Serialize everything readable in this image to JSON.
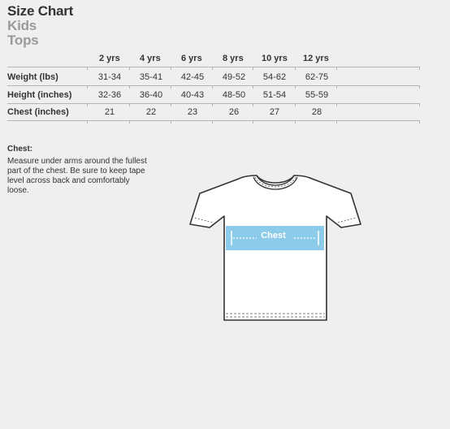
{
  "header": {
    "title": "Size Chart",
    "subtitle1": "Kids",
    "subtitle2": "Tops"
  },
  "table": {
    "columns": [
      "2 yrs",
      "4 yrs",
      "6 yrs",
      "8 yrs",
      "10 yrs",
      "12 yrs"
    ],
    "rows": [
      {
        "label": "Weight (lbs)",
        "values": [
          "31-34",
          "35-41",
          "42-45",
          "49-52",
          "54-62",
          "62-75"
        ]
      },
      {
        "label": "Height (inches)",
        "values": [
          "32-36",
          "36-40",
          "40-43",
          "48-50",
          "51-54",
          "55-59"
        ]
      },
      {
        "label": "Chest (inches)",
        "values": [
          "21",
          "22",
          "23",
          "26",
          "27",
          "28"
        ]
      }
    ]
  },
  "chest_info": {
    "title": "Chest:",
    "description": "Measure under arms around the fullest part of the chest. Be sure to keep tape level across back and comfortably loose."
  },
  "diagram": {
    "band_label": "Chest",
    "band_color": "#8ccbea"
  }
}
